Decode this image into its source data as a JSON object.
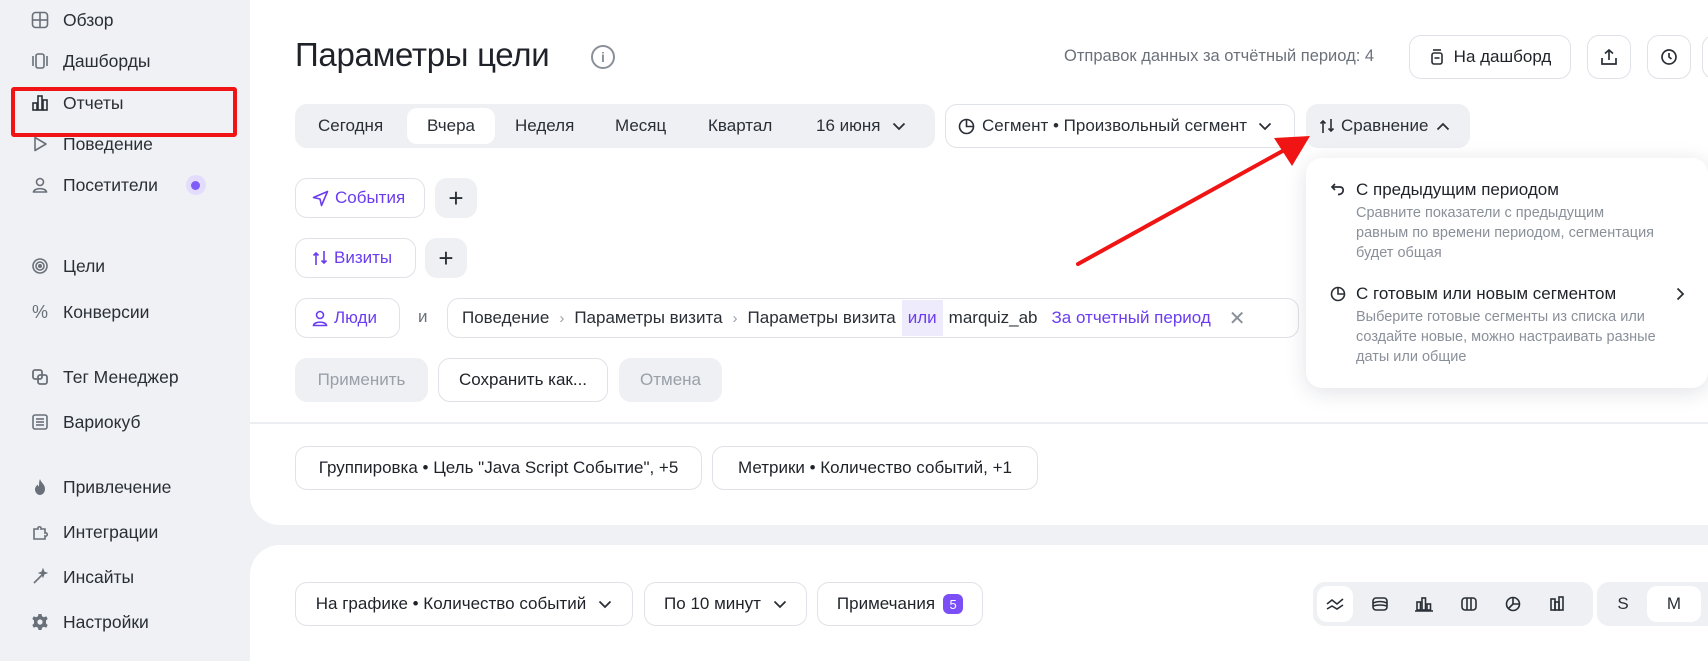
{
  "sidebar": {
    "items": [
      {
        "label": "Обзор",
        "icon": "grid-icon"
      },
      {
        "label": "Дашборды",
        "icon": "dashboards-icon"
      },
      {
        "label": "Отчеты",
        "icon": "bar-chart-icon"
      },
      {
        "label": "Поведение",
        "icon": "play-icon"
      },
      {
        "label": "Посетители",
        "icon": "user-icon"
      },
      {
        "label": "Цели",
        "icon": "target-icon"
      },
      {
        "label": "Конверсии",
        "icon": "percent-icon"
      },
      {
        "label": "Тег Менеджер",
        "icon": "tag-manager-icon"
      },
      {
        "label": "Вариокуб",
        "icon": "variocube-icon"
      },
      {
        "label": "Привлечение",
        "icon": "fire-icon"
      },
      {
        "label": "Интеграции",
        "icon": "puzzle-icon"
      },
      {
        "label": "Инсайты",
        "icon": "wand-icon"
      },
      {
        "label": "Настройки",
        "icon": "gear-icon"
      }
    ]
  },
  "header": {
    "title": "Параметры цели",
    "sends": "Отправок данных за отчётный период: 4",
    "to_dashboard": "На дашборд"
  },
  "periods": {
    "items": [
      "Сегодня",
      "Вчера",
      "Неделя",
      "Месяц",
      "Квартал",
      "16 июня"
    ],
    "active": "Вчера"
  },
  "segment": {
    "label": "Сегмент • Произвольный сегмент"
  },
  "comparison": {
    "label": "Сравнение"
  },
  "chips": {
    "events": "События",
    "visits": "Визиты",
    "people": "Люди",
    "and": "и"
  },
  "filter": {
    "part1": "Поведение",
    "part2": "Параметры визита",
    "part3": "Параметры визита",
    "or": "или",
    "value": "marquiz_ab",
    "period": "За отчетный период"
  },
  "actions": {
    "apply": "Применить",
    "save_as": "Сохранить как...",
    "cancel": "Отмена"
  },
  "dropdown": {
    "item1_title": "С предыдущим периодом",
    "item1_desc": "Сравните показатели с предыдущим равным по времени периодом, сегментация будет общая",
    "item2_title": "С готовым или новым сегментом",
    "item2_desc": "Выберите готовые сегменты из списка или создайте новые, можно настраивать разные даты или общие"
  },
  "grouping": {
    "grouping": "Группировка • Цель \"Java Script Событие\", +5",
    "metrics": "Метрики • Количество событий, +1"
  },
  "chart_toolbar": {
    "on_chart": "На графике • Количество событий",
    "interval": "По 10 минут",
    "notes": "Примечания",
    "notes_count": "5",
    "size_s": "S",
    "size_m": "M"
  },
  "colors": {
    "accent": "#6b3cf0",
    "highlight": "#f01414"
  }
}
